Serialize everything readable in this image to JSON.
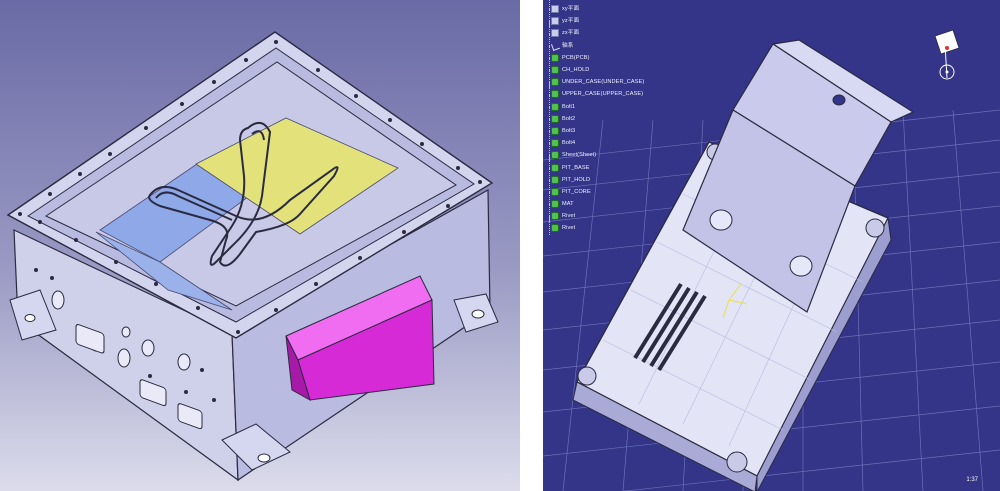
{
  "colors": {
    "left_bg_top": "#6f6ea8",
    "left_bg_bottom": "#d9d9ea",
    "right_bg": "#333489",
    "grid": "#6e71b8",
    "part_body": "#dadbf2",
    "part_shade": "#a9abd6",
    "edge": "#2a2a40",
    "pink_box": "#d92bd9",
    "yellow_plate": "#e3e27a",
    "blue_plate": "#8ea8e8",
    "tree_text": "#eef0ff",
    "tree_icon": "#4fc24f"
  },
  "tree": {
    "items": [
      {
        "label": "xy平面",
        "icon": "folder"
      },
      {
        "label": "yz平面",
        "icon": "folder"
      },
      {
        "label": "zx平面",
        "icon": "folder"
      },
      {
        "label": "轴系",
        "icon": "axis"
      },
      {
        "label": "PCB(PCB)",
        "icon": "part"
      },
      {
        "label": "CH_HOLD",
        "icon": "part"
      },
      {
        "label": "UNDER_CASE(UNDER_CASE)",
        "icon": "part"
      },
      {
        "label": "UPPER_CASE(UPPER_CASE)",
        "icon": "part"
      },
      {
        "label": "Bolt1",
        "icon": "part"
      },
      {
        "label": "Bolt2",
        "icon": "part"
      },
      {
        "label": "Bolt3",
        "icon": "part"
      },
      {
        "label": "Bolt4",
        "icon": "part"
      },
      {
        "label": "Sheet(Sheet)",
        "icon": "part"
      },
      {
        "label": "PIT_BASE",
        "icon": "part"
      },
      {
        "label": "PIT_HOLD",
        "icon": "part"
      },
      {
        "label": "PIT_CORE",
        "icon": "part"
      },
      {
        "label": "MAT",
        "icon": "part"
      },
      {
        "label": "Rivet",
        "icon": "part"
      },
      {
        "label": "Rivet",
        "icon": "part"
      }
    ]
  },
  "status": {
    "scale": "1:37"
  }
}
